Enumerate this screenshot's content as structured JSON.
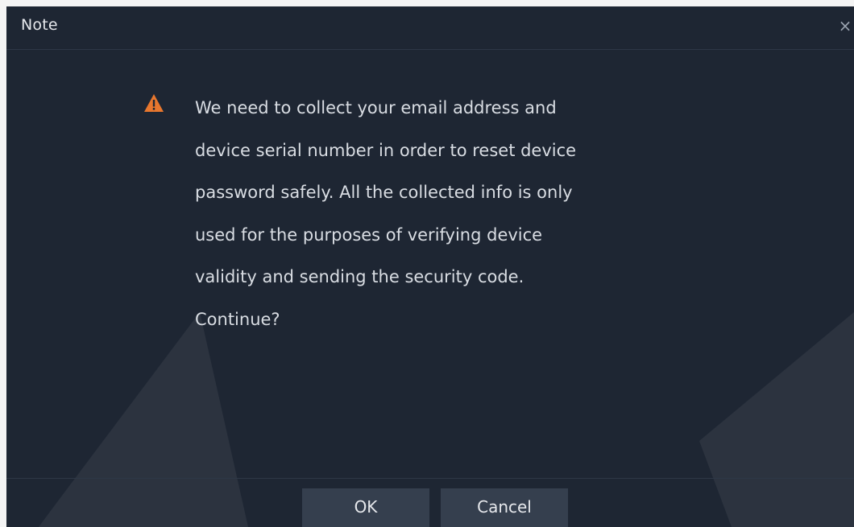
{
  "dialog": {
    "title": "Note",
    "close_symbol": "×",
    "icon": "warning-triangle-icon",
    "message_lines": [
      "We need to collect your email address and",
      "device serial number in order to reset device",
      "password safely. All the collected info is only",
      "used for the purposes of verifying device",
      "validity and sending the security code.",
      "Continue?"
    ],
    "buttons": {
      "ok": "OK",
      "cancel": "Cancel"
    }
  },
  "colors": {
    "background": "#1e2633",
    "button": "#353f4e",
    "warning": "#e8772e",
    "text": "#d9dde3"
  }
}
